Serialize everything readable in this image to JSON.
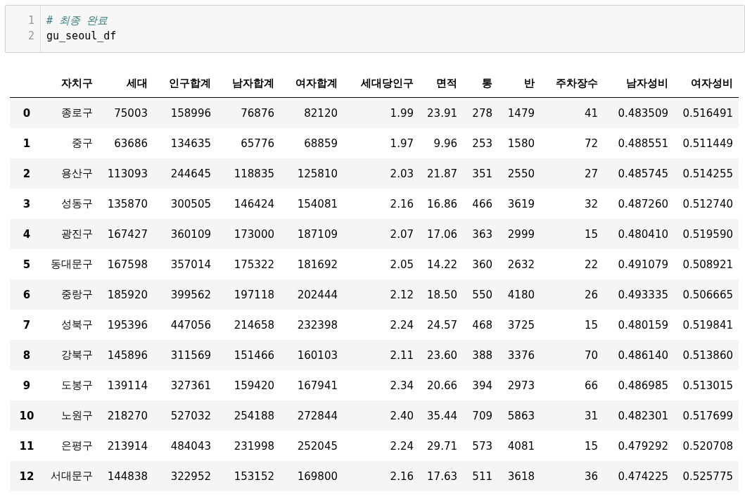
{
  "code_cell": {
    "lines": [
      {
        "number": "1",
        "kind": "comment",
        "text": "# 최종 완료"
      },
      {
        "number": "2",
        "kind": "code",
        "text": "gu_seoul_df"
      }
    ]
  },
  "table": {
    "columns": [
      "",
      "자치구",
      "세대",
      "인구합계",
      "남자합계",
      "여자합계",
      "세대당인구",
      "면적",
      "통",
      "반",
      "주차장수",
      "남자성비",
      "여자성비"
    ],
    "rows": [
      [
        "0",
        "종로구",
        "75003",
        "158996",
        "76876",
        "82120",
        "1.99",
        "23.91",
        "278",
        "1479",
        "41",
        "0.483509",
        "0.516491"
      ],
      [
        "1",
        "중구",
        "63686",
        "134635",
        "65776",
        "68859",
        "1.97",
        "9.96",
        "253",
        "1580",
        "72",
        "0.488551",
        "0.511449"
      ],
      [
        "2",
        "용산구",
        "113093",
        "244645",
        "118835",
        "125810",
        "2.03",
        "21.87",
        "351",
        "2550",
        "27",
        "0.485745",
        "0.514255"
      ],
      [
        "3",
        "성동구",
        "135870",
        "300505",
        "146424",
        "154081",
        "2.16",
        "16.86",
        "466",
        "3619",
        "32",
        "0.487260",
        "0.512740"
      ],
      [
        "4",
        "광진구",
        "167427",
        "360109",
        "173000",
        "187109",
        "2.07",
        "17.06",
        "363",
        "2999",
        "15",
        "0.480410",
        "0.519590"
      ],
      [
        "5",
        "동대문구",
        "167598",
        "357014",
        "175322",
        "181692",
        "2.05",
        "14.22",
        "360",
        "2632",
        "22",
        "0.491079",
        "0.508921"
      ],
      [
        "6",
        "중랑구",
        "185920",
        "399562",
        "197118",
        "202444",
        "2.12",
        "18.50",
        "550",
        "4180",
        "26",
        "0.493335",
        "0.506665"
      ],
      [
        "7",
        "성북구",
        "195396",
        "447056",
        "214658",
        "232398",
        "2.24",
        "24.57",
        "468",
        "3725",
        "15",
        "0.480159",
        "0.519841"
      ],
      [
        "8",
        "강북구",
        "145896",
        "311569",
        "151466",
        "160103",
        "2.11",
        "23.60",
        "388",
        "3376",
        "70",
        "0.486140",
        "0.513860"
      ],
      [
        "9",
        "도봉구",
        "139114",
        "327361",
        "159420",
        "167941",
        "2.34",
        "20.66",
        "394",
        "2973",
        "66",
        "0.486985",
        "0.513015"
      ],
      [
        "10",
        "노원구",
        "218270",
        "527032",
        "254188",
        "272844",
        "2.40",
        "35.44",
        "709",
        "5863",
        "31",
        "0.482301",
        "0.517699"
      ],
      [
        "11",
        "은평구",
        "213914",
        "484043",
        "231998",
        "252045",
        "2.24",
        "29.71",
        "573",
        "4081",
        "15",
        "0.479292",
        "0.520708"
      ],
      [
        "12",
        "서대문구",
        "144838",
        "322952",
        "153152",
        "169800",
        "2.16",
        "17.63",
        "511",
        "3618",
        "36",
        "0.474225",
        "0.525775"
      ]
    ]
  }
}
